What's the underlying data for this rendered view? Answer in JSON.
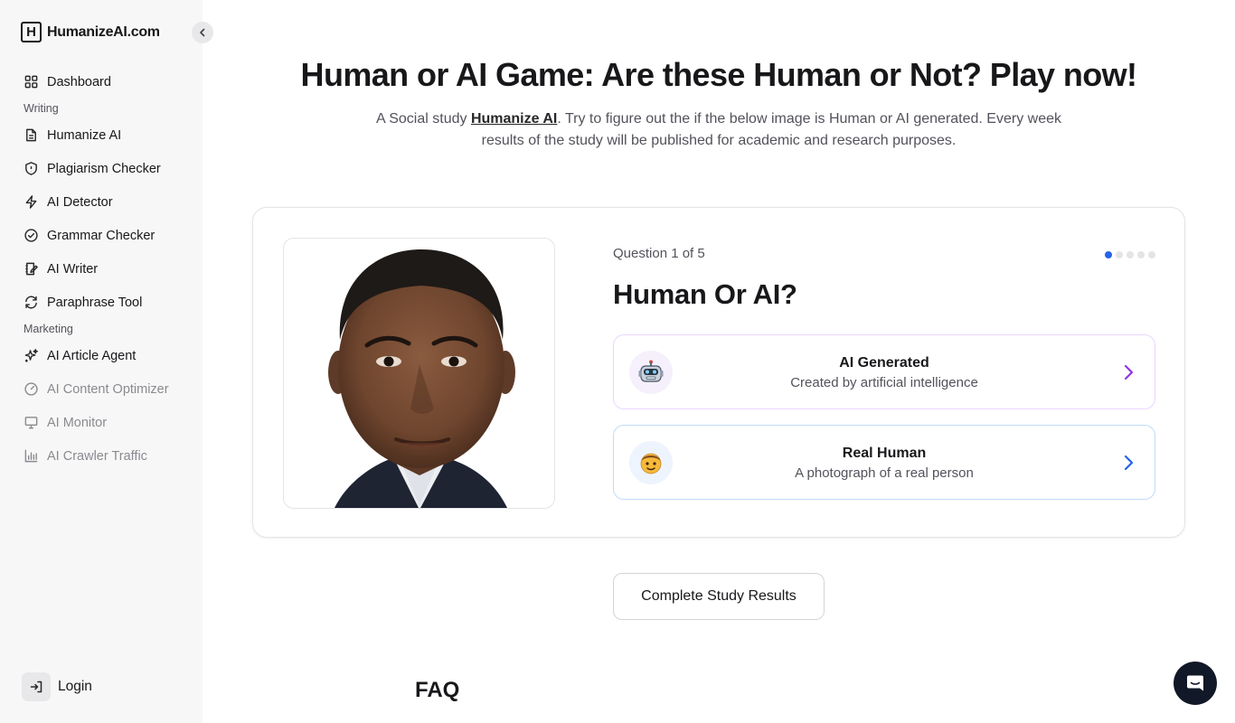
{
  "sidebar": {
    "brand": "HumanizeAI.com",
    "brand_mark": "H",
    "items": [
      {
        "label": "Dashboard",
        "icon": "grid-icon"
      },
      {
        "label": "Humanize AI",
        "icon": "document-icon"
      },
      {
        "label": "Plagiarism Checker",
        "icon": "shield-icon"
      },
      {
        "label": "AI Detector",
        "icon": "lightning-icon"
      },
      {
        "label": "Grammar Checker",
        "icon": "check-circle-icon"
      },
      {
        "label": "AI Writer",
        "icon": "notebook-pen-icon"
      },
      {
        "label": "Paraphrase Tool",
        "icon": "refresh-icon"
      },
      {
        "label": "AI Article Agent",
        "icon": "sparkles-icon"
      },
      {
        "label": "AI Content Optimizer",
        "icon": "gauge-icon"
      },
      {
        "label": "AI Monitor",
        "icon": "monitor-icon"
      },
      {
        "label": "AI Crawler Traffic",
        "icon": "bar-chart-icon"
      }
    ],
    "sections": {
      "writing": "Writing",
      "marketing": "Marketing"
    },
    "login_label": "Login"
  },
  "main": {
    "title": "Human or AI Game: Are these Human or Not? Play now!",
    "subtitle_before": "A Social study ",
    "subtitle_link": "Humanize AI",
    "subtitle_after": ". Try to figure out the if the below image is Human or AI generated. Every week results of the study will be published for academic and research purposes.",
    "question_counter": "Question 1 of 5",
    "question_total": 5,
    "question_current": 1,
    "question_title": "Human Or AI?",
    "options": [
      {
        "title": "AI Generated",
        "subtitle": "Created by artificial intelligence",
        "icon": "robot-icon",
        "accent": "#9333ea"
      },
      {
        "title": "Real Human",
        "subtitle": "A photograph of a real person",
        "icon": "person-face-icon",
        "accent": "#2563eb"
      }
    ],
    "results_button": "Complete Study Results",
    "faq_heading": "FAQ"
  },
  "colors": {
    "sidebar_bg": "#f7f7f7",
    "active_dot": "#2563eb",
    "chat_button": "#111827"
  }
}
